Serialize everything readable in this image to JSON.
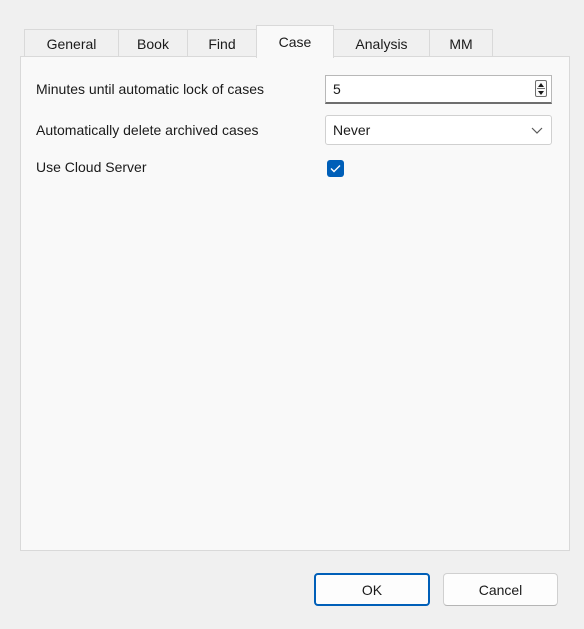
{
  "tabs": [
    {
      "label": "General"
    },
    {
      "label": "Book"
    },
    {
      "label": "Find"
    },
    {
      "label": "Case"
    },
    {
      "label": "Analysis"
    },
    {
      "label": "MM"
    }
  ],
  "active_tab": "Case",
  "case_settings": {
    "lock_label": "Minutes until automatic lock of cases",
    "lock_value": "5",
    "delete_label": "Automatically delete archived cases",
    "delete_value": "Never",
    "cloud_label": "Use Cloud Server",
    "cloud_checked": true
  },
  "buttons": {
    "ok_label": "OK",
    "cancel_label": "Cancel"
  },
  "colors": {
    "accent": "#005fb8",
    "panel_bg": "#f9f9f9",
    "dialog_bg": "#f0f0f0"
  },
  "icons": {
    "spin_up": "triangle-up-icon",
    "spin_down": "triangle-down-icon",
    "combo": "chevron-down-icon",
    "check": "checkmark-icon"
  }
}
